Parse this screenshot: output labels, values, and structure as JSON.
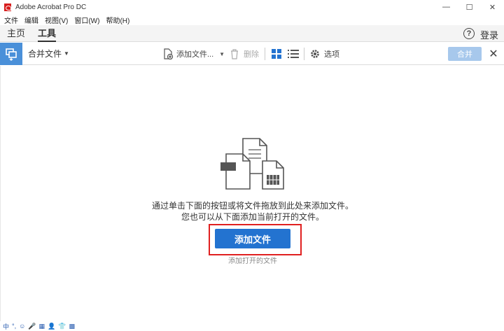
{
  "window": {
    "title": "Adobe Acrobat Pro DC",
    "controls": {
      "minimize": "—",
      "maximize": "☐",
      "close": "✕"
    }
  },
  "menu": [
    "文件",
    "编辑",
    "视图(V)",
    "窗口(W)",
    "帮助(H)"
  ],
  "tabs": [
    {
      "label": "主页",
      "active": false
    },
    {
      "label": "工具",
      "active": true
    }
  ],
  "header": {
    "help_symbol": "?",
    "login": "登录"
  },
  "toolbar": {
    "tool_name": "合并文件",
    "add_files": "添加文件...",
    "delete": "删除",
    "options": "选项",
    "merge": "合并"
  },
  "main": {
    "instruction_line1": "通过单击下面的按钮或将文件拖放到此处来添加文件。",
    "instruction_line2": "您也可以从下面添加当前打开的文件。",
    "add_button": "添加文件",
    "add_open_files": "添加打开的文件"
  },
  "tray": [
    "中",
    "°,",
    "☺",
    "🎤",
    "▦",
    "👤",
    "👕",
    "▩"
  ],
  "colors": {
    "accent": "#2373d0",
    "tool_icon_bg": "#4a90d9",
    "merge_disabled": "#a7c8ec",
    "highlight": "#e02020"
  }
}
